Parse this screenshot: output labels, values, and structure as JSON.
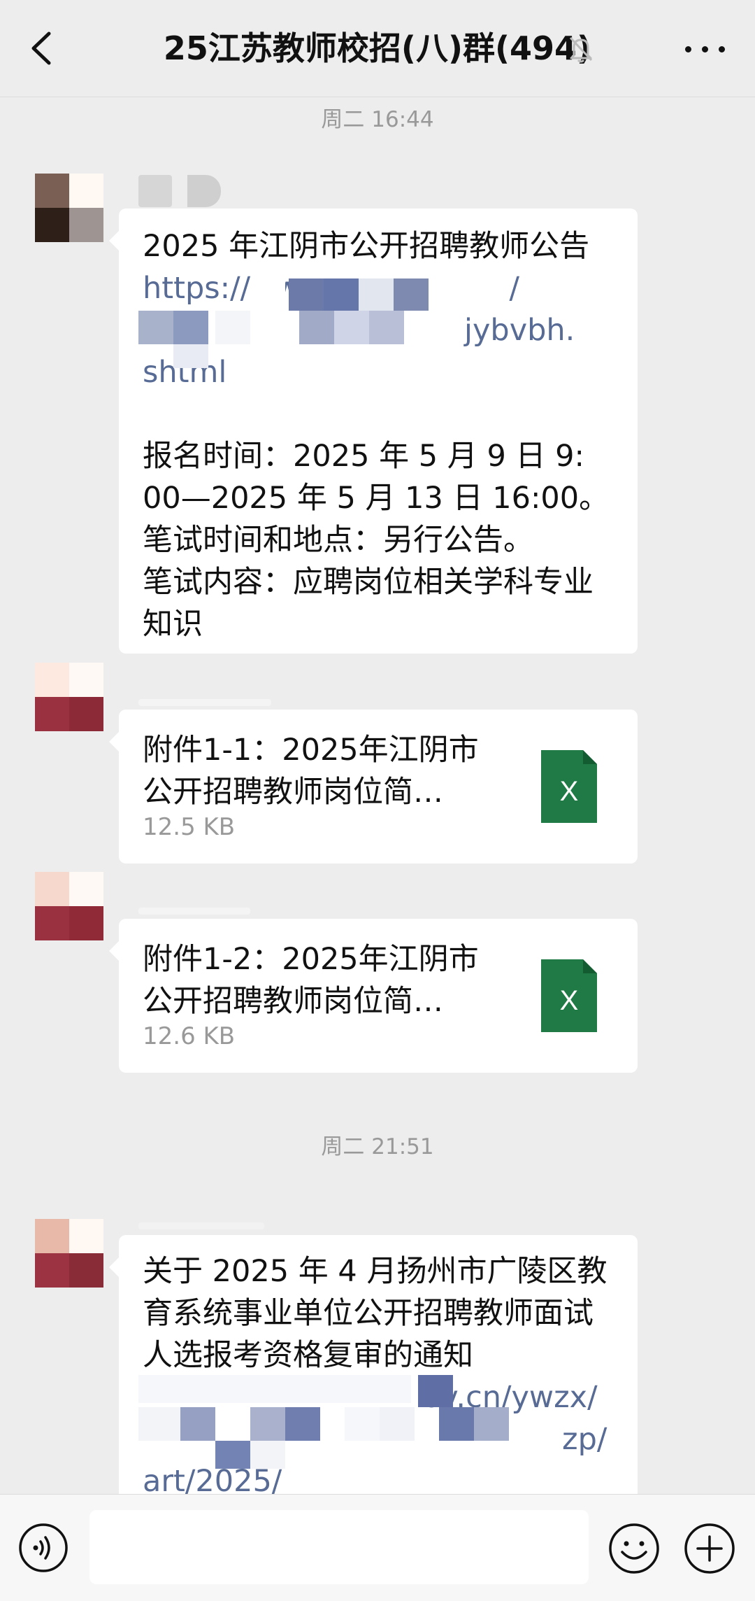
{
  "header": {
    "title": "25江苏教师校招(八)群(494)"
  },
  "timestamps": [
    "周二 16:44",
    "周二 21:51"
  ],
  "messages": {
    "m1_title": "2025 年江阴市公开招聘教师公告",
    "m1_link1": "https://ww",
    "m1_link1b": "/",
    "m1_link2": "jybvbh.",
    "m1_link3": "shtml",
    "m1_body": "报名时间：2025 年 5 月 9 日 9:\n00—2025 年 5 月 13 日 16:00。\n笔试时间和地点：另行公告。\n笔试内容：应聘岗位相关学科专业\n知识",
    "file1_name": "附件1-1：2025年江阴市\n公开招聘教师岗位简…",
    "file1_size": "12.5 KB",
    "file2_name": "附件1-2：2025年江阴市\n公开招聘教师岗位简…",
    "file2_size": "12.6 KB",
    "m4_title": "关于 2025 年 4 月扬州市广陵区教\n育系统事业单位公开招聘教师面试\n人选报考资格复审的通知",
    "m4_link1": "ov.cn/ywzx/",
    "m4_link2": "zp/",
    "m4_link3": "art/2025/"
  },
  "icons": {
    "back": "chevron-left-icon",
    "bell": "muted-bell-icon",
    "more": "more-icon",
    "excel": "excel-file-icon",
    "voice": "voice-icon",
    "emoji": "emoji-icon",
    "plus": "plus-icon"
  },
  "colors": {
    "link": "#576b95",
    "excel_green": "#1f7a45",
    "background": "#ededed"
  }
}
